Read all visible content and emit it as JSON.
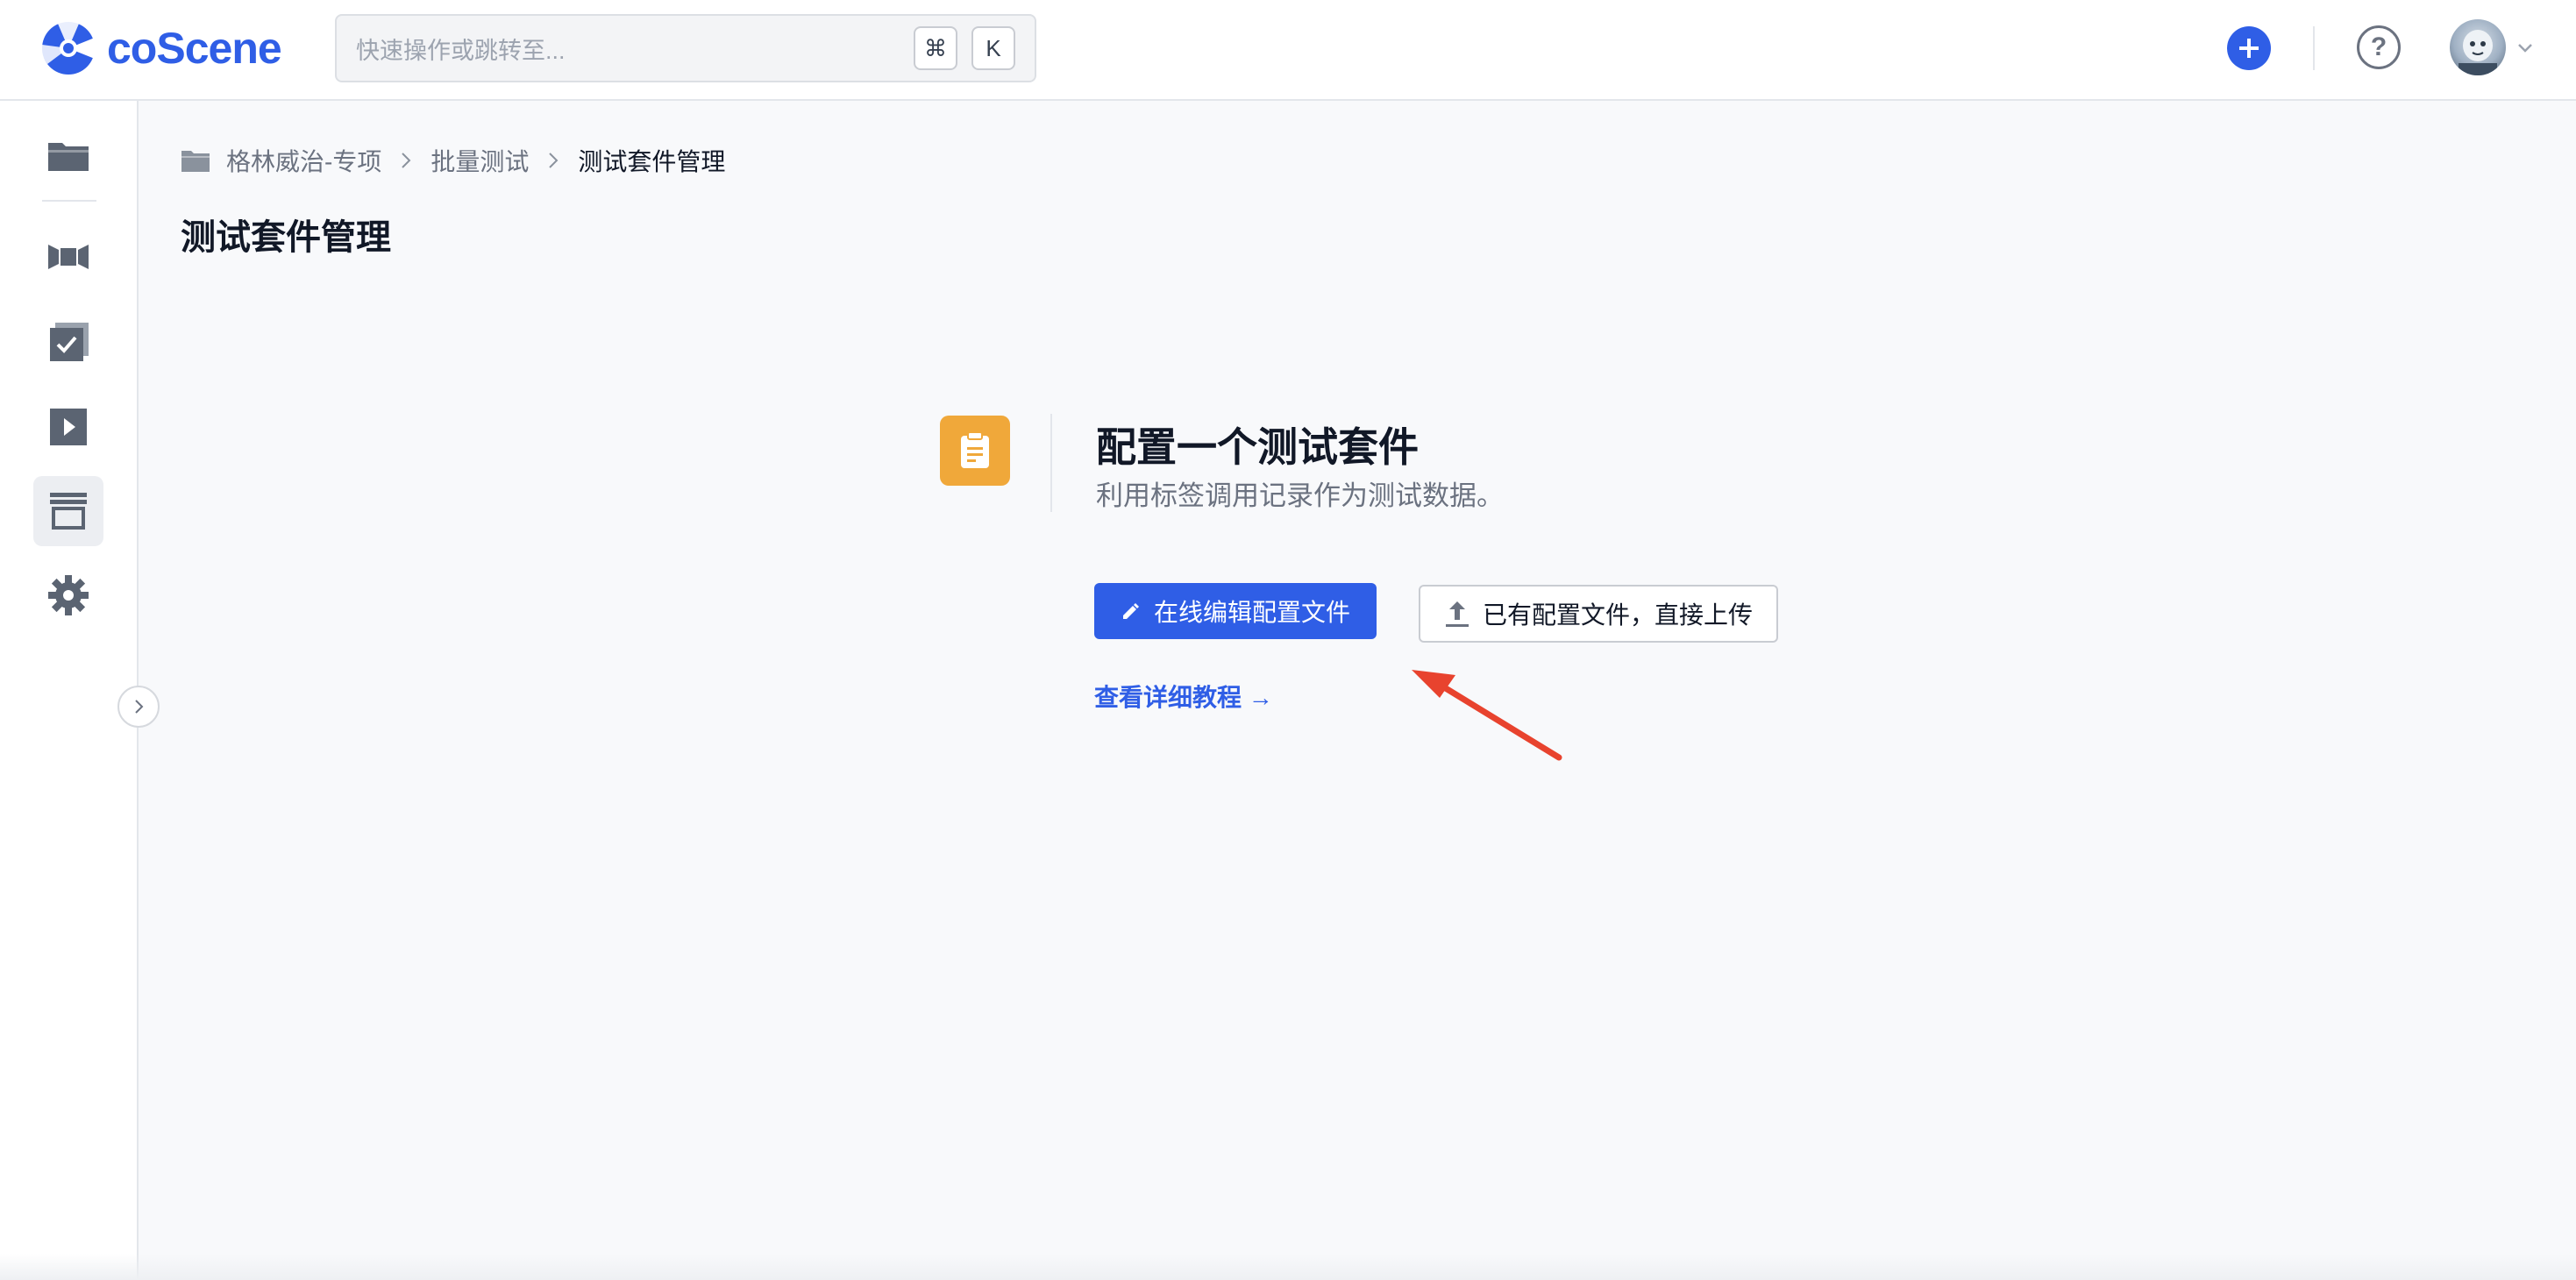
{
  "header": {
    "logo_text": "coScene",
    "search_placeholder": "快速操作或跳转至...",
    "shortcut_keys": [
      "⌘",
      "K"
    ],
    "help_label": "?",
    "accent_color": "#2f5ee6"
  },
  "sidebar": {
    "items": [
      {
        "icon": "folder-icon"
      },
      {
        "icon": "video-camera-icon"
      },
      {
        "icon": "checklist-icon"
      },
      {
        "icon": "play-icon"
      },
      {
        "icon": "archive-box-icon",
        "active": true
      },
      {
        "icon": "gear-icon"
      }
    ]
  },
  "breadcrumb": {
    "items": [
      "格林威治-专项",
      "批量测试",
      "测试套件管理"
    ]
  },
  "page": {
    "title": "测试套件管理"
  },
  "setup": {
    "icon": "clipboard-icon",
    "icon_color": "#f0a83a",
    "title": "配置一个测试套件",
    "subtitle": "利用标签调用记录作为测试数据。",
    "primary_button": "在线编辑配置文件",
    "secondary_button": "已有配置文件，直接上传",
    "tutorial_link": "查看详细教程 →"
  },
  "annotation": {
    "arrow_color": "#e8432e"
  }
}
